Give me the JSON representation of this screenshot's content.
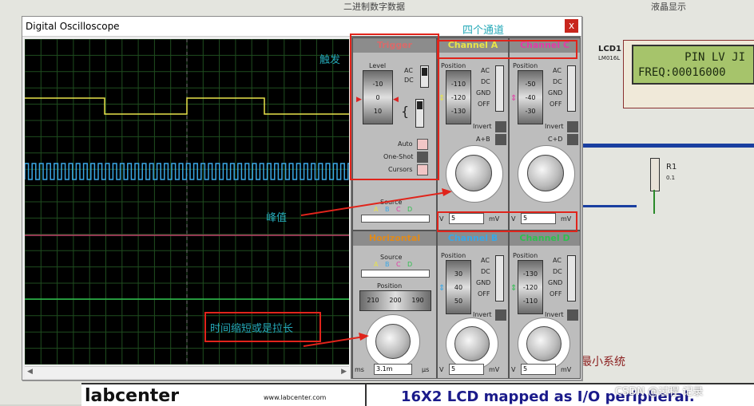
{
  "window": {
    "title": "Digital Oscilloscope",
    "close": "x"
  },
  "panel": {
    "trigger": {
      "title": "Trigger",
      "level_label": "Level",
      "drum": [
        "-10",
        "0",
        "10"
      ],
      "coupling": [
        "AC",
        "DC"
      ],
      "auto": "Auto",
      "one_shot": "One-Shot",
      "cursors": "Cursors",
      "source_label": "Source",
      "sources": [
        "A",
        "B",
        "C",
        "D"
      ]
    },
    "channel_a": {
      "title": "Channel A",
      "position": "Position",
      "drum": [
        "-110",
        "-120",
        "-130"
      ],
      "modes": [
        "AC",
        "DC",
        "GND",
        "OFF"
      ],
      "invert": "Invert",
      "extra": "A+B",
      "scale_left": "V",
      "value": "5",
      "unit": "mV"
    },
    "channel_c": {
      "title": "Channel C",
      "position": "Position",
      "drum": [
        "-50",
        "-40",
        "-30"
      ],
      "modes": [
        "AC",
        "DC",
        "GND",
        "OFF"
      ],
      "invert": "Invert",
      "extra": "C+D",
      "scale_left": "V",
      "value": "5",
      "unit": "mV"
    },
    "horizontal": {
      "title": "Horizontal",
      "source_label": "Source",
      "sources": [
        "A",
        "B",
        "C",
        "D"
      ],
      "position_label": "Position",
      "drum": [
        "210",
        "200",
        "190"
      ],
      "left_unit": "ms",
      "value": "3.1m",
      "right_unit": "µs"
    },
    "channel_b": {
      "title": "Channel B",
      "position": "Position",
      "drum": [
        "30",
        "40",
        "50"
      ],
      "modes": [
        "AC",
        "DC",
        "GND",
        "OFF"
      ],
      "invert": "Invert",
      "scale_left": "V",
      "value": "5",
      "unit": "mV"
    },
    "channel_d": {
      "title": "Channel D",
      "position": "Position",
      "drum": [
        "-130",
        "-120",
        "-110"
      ],
      "modes": [
        "AC",
        "DC",
        "GND",
        "OFF"
      ],
      "invert": "Invert",
      "scale_left": "V",
      "value": "5",
      "unit": "mV"
    }
  },
  "annotations": {
    "trigger": "触发",
    "four_channels": "四个通道",
    "peak": "峰值",
    "time": "时间缩短或是拉长"
  },
  "schematic": {
    "lcd_ref": "LCD1",
    "lcd_model": "LM016L",
    "lcd_line1": "PIN LV JI",
    "lcd_line2": "FREQ:00016000",
    "resistor_ref": "R1",
    "resistor_value": "0.1",
    "top_text_1": "二进制数字数据",
    "top_text_2": "液晶显示",
    "min_system": "最小系统",
    "bottom_brand": "labcenter",
    "bottom_url": "www.labcenter.com",
    "bottom_caption": "16X2 LCD mapped as I/O peripheral.",
    "watermark": "CSDN @过程 记录"
  },
  "colors": {
    "ch_a": "#e8e34a",
    "ch_b": "#3aa7e6",
    "ch_c": "#e23ca6",
    "ch_d": "#2fbf4f",
    "trigger": "#d96a6a",
    "horizontal": "#e08a1a",
    "annotation": "#25a9b8",
    "box": "#e0241b"
  }
}
